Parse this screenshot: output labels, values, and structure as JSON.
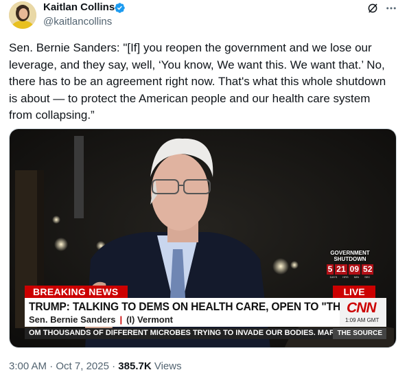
{
  "author": {
    "name": "Kaitlan Collins",
    "handle": "@kaitlancollins",
    "verified_color": "#1d9bf0"
  },
  "tweet": {
    "text": "Sen. Bernie Sanders: \"[If] you reopen the government and we lose our leverage, and they say, well, ‘You know, We want this. We want that.’ No, there has to be an agreement right now. That's what this whole shutdown is about — to protect the American people and our health care system from collapsing.”"
  },
  "icons": {
    "grok": "grok-icon",
    "more": "more-icon"
  },
  "video": {
    "breaking_label": "BREAKING NEWS",
    "live_label": "LIVE",
    "headline": "TRUMP: TALKING TO DEMS ON HEALTH CARE, OPEN TO \"THE RIGHT DEAL\"",
    "speaker_name": "Sen. Bernie Sanders",
    "speaker_separator": "|",
    "speaker_affiliation": "(I) Vermont",
    "network_logo": "CNN",
    "network_time": "1:09 AM GMT",
    "ticker_text": "OM THOUSANDS OF DIFFERENT MICROBES TRYING TO INVADE OUR BODIES. MARY",
    "ticker_source": "THE SOURCE",
    "shutdown": {
      "label_line1": "GOVERNMENT",
      "label_line2": "SHUTDOWN",
      "days": "5",
      "hours": "21",
      "minutes": "09",
      "seconds": "52",
      "unit_days": "DAYS",
      "unit_hours": "HRS",
      "unit_minutes": "MIN",
      "unit_seconds": "SEC"
    },
    "accent_color": "#cc0000"
  },
  "meta": {
    "time": "3:00 AM",
    "separator": "·",
    "date": "Oct 7, 2025",
    "views_count": "385.7K",
    "views_label": "Views"
  }
}
